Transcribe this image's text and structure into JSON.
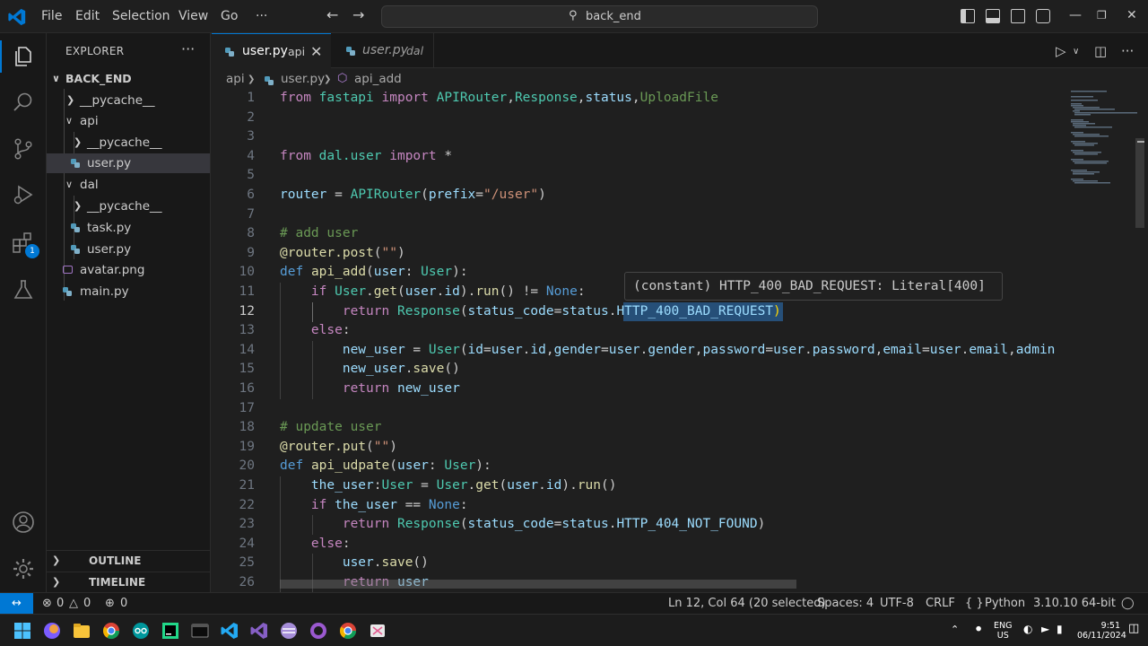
{
  "window": {
    "menu": [
      "File",
      "Edit",
      "Selection",
      "View",
      "Go"
    ],
    "more": "···",
    "search_text": "back_end"
  },
  "explorer": {
    "title": "EXPLORER",
    "more": "···",
    "root": "BACK_END",
    "items": [
      {
        "label": "__pycache__"
      },
      {
        "label": "api"
      },
      {
        "label": "__pycache__"
      },
      {
        "label": "user.py"
      },
      {
        "label": "dal"
      },
      {
        "label": "__pycache__"
      },
      {
        "label": "task.py"
      },
      {
        "label": "user.py"
      },
      {
        "label": "avatar.png"
      },
      {
        "label": "main.py"
      }
    ],
    "outline": "OUTLINE",
    "timeline": "TIMELINE"
  },
  "activity": {
    "extensions_badge": "1"
  },
  "tabs": [
    {
      "name": "user.py",
      "desc": "api"
    },
    {
      "name": "user.py",
      "desc": "dal"
    }
  ],
  "breadcrumb": {
    "folder": "api",
    "file": "user.py",
    "symbol": "api_add"
  },
  "editor": {
    "line_numbers": [
      "1",
      "2",
      "3",
      "4",
      "5",
      "6",
      "7",
      "8",
      "9",
      "10",
      "11",
      "12",
      "13",
      "14",
      "15",
      "16",
      "17",
      "18",
      "19",
      "20",
      "21",
      "22",
      "23",
      "24",
      "25",
      "26"
    ],
    "hover_text": "(constant) HTTP_400_BAD_REQUEST: Literal[400]"
  },
  "status": {
    "errors": "0",
    "warnings": "0",
    "ports": "0",
    "position": "Ln 12, Col 64 (20 selected)",
    "spaces": "Spaces: 4",
    "encoding": "UTF-8",
    "eol": "CRLF",
    "language": "Python",
    "lang_icon": "{ }",
    "interpreter": "3.10.10 64-bit"
  },
  "taskbar": {
    "lang_top": "ENG",
    "lang_bottom": "US",
    "time": "9:51",
    "date": "06/11/2024"
  },
  "colors": {
    "accent": "#0078d4",
    "editor_bg": "#1f1f1f",
    "sidebar_bg": "#181818"
  }
}
